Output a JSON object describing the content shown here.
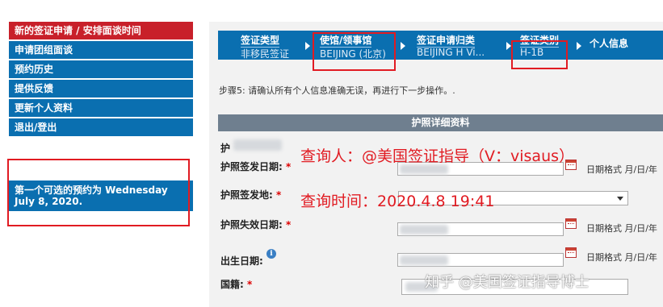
{
  "sidebar": {
    "items": [
      {
        "label": "新的签证申请 / 安排面谈时间"
      },
      {
        "label": "申请团组面谈"
      },
      {
        "label": "预约历史"
      },
      {
        "label": "提供反馈"
      },
      {
        "label": "更新个人资料"
      },
      {
        "label": "退出/登出"
      }
    ],
    "first_appointment": "第一个可选的预约为 Wednesday July 8, 2020."
  },
  "steps": [
    {
      "label": "签证类型",
      "value": "非移民签证"
    },
    {
      "label": "使馆/领事馆",
      "value": "BEIJING (北京)"
    },
    {
      "label": "签证申请归类",
      "value": "BEIJING H Vi..."
    },
    {
      "label": "签证类别",
      "value": "H-1B"
    },
    {
      "label": "个人信息",
      "value": ""
    }
  ],
  "instruction": "步骤5: 请确认所有个人信息准确无误，再进行下一步操作。.",
  "section_title": "护照详细资料",
  "fields": {
    "passport_number_partial": "护",
    "issue_date_label": "护照签发日期:",
    "issue_place_label": "护照签发地:",
    "expiry_date_label": "护照失效日期:",
    "birth_date_label": "出生日期:",
    "nationality_label": "国籍:",
    "required_mark": "*",
    "date_format_hint": "日期格式 月/日/年"
  },
  "overlay": {
    "inquirer": "查询人：@美国签证指导（V：visaus）",
    "query_time": "查询时间：2020.4.8   19:41"
  },
  "watermark": "知乎 @美国签证指导博士",
  "colors": {
    "nav_blue": "#0a6fb0",
    "active_red": "#c8202a",
    "annotation_red": "#e11b22",
    "section_gray": "#6f7f8f"
  }
}
